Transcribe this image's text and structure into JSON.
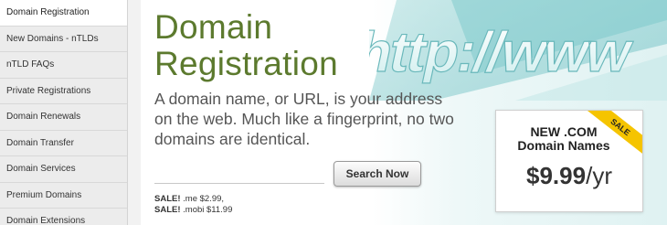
{
  "sidebar": {
    "items": [
      {
        "label": "Domain Registration"
      },
      {
        "label": "New Domains - nTLDs"
      },
      {
        "label": "nTLD FAQs"
      },
      {
        "label": "Private Registrations"
      },
      {
        "label": "Domain Renewals"
      },
      {
        "label": "Domain Transfer"
      },
      {
        "label": "Domain Services"
      },
      {
        "label": "Premium Domains"
      },
      {
        "label": "Domain Extensions"
      }
    ]
  },
  "hero": {
    "title_line1": "Domain",
    "title_line2": "Registration",
    "description": "A domain name, or URL, is your address on the web. Much like a fingerprint, no two domains are identical.",
    "art_text": "http://www",
    "search": {
      "value": "",
      "button_label": "Search Now"
    },
    "sales": [
      {
        "prefix": "SALE!",
        "text": " .me $2.99,"
      },
      {
        "prefix": "SALE!",
        "text": " .mobi $11.99"
      }
    ]
  },
  "promo": {
    "line1": "NEW .COM",
    "line2": "Domain Names",
    "price": "$9.99",
    "period": "/yr",
    "ribbon": "SALE"
  },
  "colors": {
    "title_green": "#5c7a2e",
    "ribbon_yellow": "#f5c400",
    "sidebar_bg": "#ececec"
  }
}
